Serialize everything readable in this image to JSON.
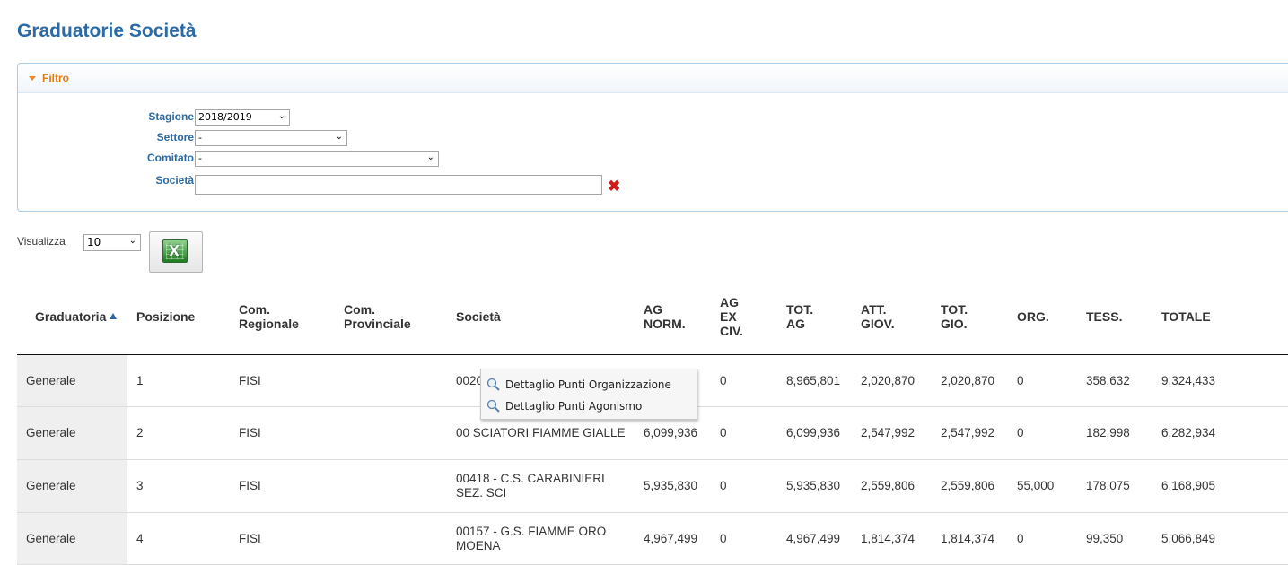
{
  "page": {
    "title": "Graduatorie Società"
  },
  "filter": {
    "toggle_label": "Filtro",
    "stagione": {
      "label": "Stagione",
      "value": "2018/2019"
    },
    "settore": {
      "label": "Settore",
      "value": "-"
    },
    "comitato": {
      "label": "Comitato",
      "value": "-"
    },
    "societa": {
      "label": "Società",
      "value": ""
    }
  },
  "toolbar": {
    "visualizza_label": "Visualizza",
    "page_size": "10",
    "excel_glyph": "X"
  },
  "table": {
    "headers": [
      [
        "Graduatoria"
      ],
      [
        "Posizione"
      ],
      [
        "Com.",
        "Regionale"
      ],
      [
        "Com.",
        "Provinciale"
      ],
      [
        "Società"
      ],
      [
        "AG",
        "NORM."
      ],
      [
        "AG",
        "EX",
        "CIV."
      ],
      [
        "TOT.",
        "AG"
      ],
      [
        "ATT.",
        "GIOV."
      ],
      [
        "TOT.",
        "GIO."
      ],
      [
        "ORG."
      ],
      [
        "TESS."
      ],
      [
        "TOTALE"
      ]
    ],
    "rows": [
      [
        "Generale",
        "1",
        "FISI",
        "",
        "00209 - C.S. ESERCITO",
        "8,965,801",
        "0",
        "8,965,801",
        "2,020,870",
        "2,020,870",
        "0",
        "358,632",
        "9,324,433"
      ],
      [
        "Generale",
        "2",
        "FISI",
        "",
        "00 SCIATORI FIAMME GIALLE",
        "6,099,936",
        "0",
        "6,099,936",
        "2,547,992",
        "2,547,992",
        "0",
        "182,998",
        "6,282,934"
      ],
      [
        "Generale",
        "3",
        "FISI",
        "",
        "00418 - C.S. CARABINIERI SEZ. SCI",
        "5,935,830",
        "0",
        "5,935,830",
        "2,559,806",
        "2,559,806",
        "55,000",
        "178,075",
        "6,168,905"
      ],
      [
        "Generale",
        "4",
        "FISI",
        "",
        "00157 - G.S. FIAMME ORO MOENA",
        "4,967,499",
        "0",
        "4,967,499",
        "1,814,374",
        "1,814,374",
        "0",
        "99,350",
        "5,066,849"
      ]
    ]
  },
  "context_menu": {
    "items": [
      {
        "label": "Dettaglio Punti Organizzazione",
        "icon": "magnifier-icon"
      },
      {
        "label": "Dettaglio Punti Agonismo",
        "icon": "magnifier-icon"
      }
    ]
  },
  "colors": {
    "accent": "#2b6aa5",
    "filter_link": "#e07b10",
    "clear": "#d11a1a"
  }
}
